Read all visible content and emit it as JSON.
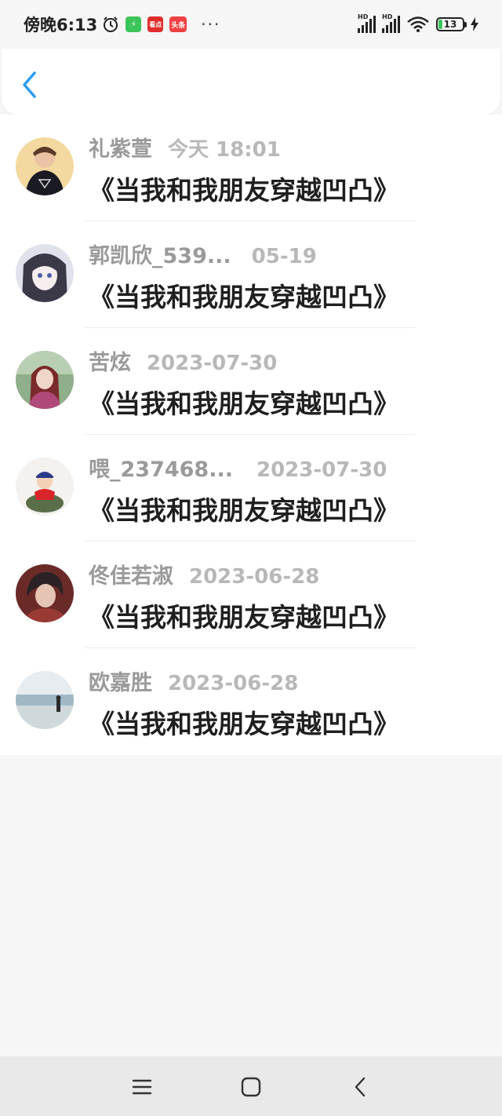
{
  "status_bar": {
    "time": "傍晚6:13",
    "app_badges": [
      "看点",
      "头条"
    ],
    "battery": "13"
  },
  "header": {
    "back_icon": "chevron-left-icon"
  },
  "comments": [
    {
      "name": "礼紫萱",
      "time": "今天 18:01",
      "title": "《当我和我朋友穿越凹凸》"
    },
    {
      "name": "郭凯欣_539...",
      "time": "05-19",
      "title": "《当我和我朋友穿越凹凸》"
    },
    {
      "name": "苦炫",
      "time": "2023-07-30",
      "title": "《当我和我朋友穿越凹凸》"
    },
    {
      "name": "喂_237468...",
      "time": "2023-07-30",
      "title": "《当我和我朋友穿越凹凸》"
    },
    {
      "name": "佟佳若淑",
      "time": "2023-06-28",
      "title": "《当我和我朋友穿越凹凸》"
    },
    {
      "name": "欧嘉胜",
      "time": "2023-06-28",
      "title": "《当我和我朋友穿越凹凸》"
    }
  ],
  "nav_bar": {
    "menu_icon": "menu-icon",
    "home_icon": "home-square-icon",
    "back_icon": "back-icon"
  },
  "colors": {
    "accent": "#2d9cf0",
    "name_gray": "#9a9a9a",
    "time_gray": "#b8b8b8"
  }
}
